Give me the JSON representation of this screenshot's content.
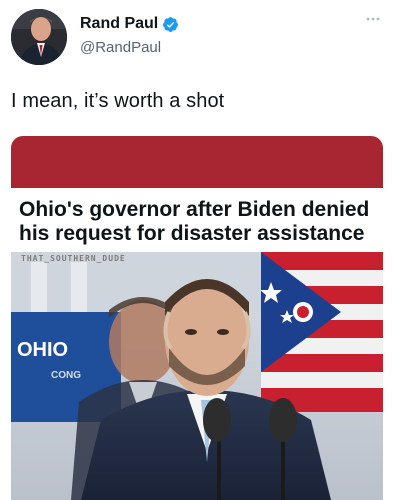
{
  "author": {
    "display_name": "Rand Paul",
    "handle": "@RandPaul",
    "verified": true
  },
  "tweet": {
    "text": "I mean, it’s worth a shot"
  },
  "media": {
    "headline": "Ohio's governor after Biden denied his request for disaster assistance",
    "watermark": "THAT_SOUTHERN_DUDE",
    "podium_text_1": "OHIO",
    "podium_text_2": "CONG"
  },
  "colors": {
    "verified_blue": "#1d9bf0",
    "card_band": "#a82532",
    "text_primary": "#0f1419",
    "text_secondary": "#536471"
  },
  "icons": {
    "verified": "verified-badge-icon",
    "more": "more-options-icon"
  }
}
